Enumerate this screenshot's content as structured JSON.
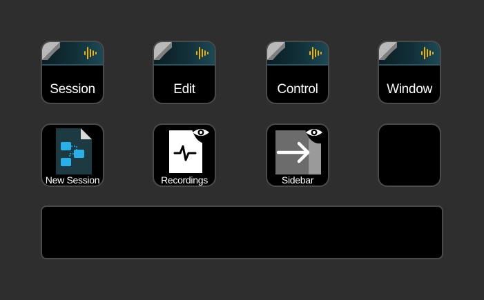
{
  "app": {
    "background": "#2e2e2e",
    "key_border": "#4a4a4a"
  },
  "row1": [
    {
      "label": "Session",
      "icon": "audio-waveform-icon",
      "kind": "folder"
    },
    {
      "label": "Edit",
      "icon": "audio-waveform-icon",
      "kind": "folder"
    },
    {
      "label": "Control",
      "icon": "audio-waveform-icon",
      "kind": "folder"
    },
    {
      "label": "Window",
      "icon": "audio-waveform-icon",
      "kind": "folder"
    }
  ],
  "row2": [
    {
      "label": "New Session",
      "icon": "new-session-document-icon"
    },
    {
      "label": "Recordings",
      "icon": "recordings-waveform-icon",
      "badge": "eye-icon"
    },
    {
      "label": "Sidebar",
      "icon": "sidebar-arrow-icon",
      "badge": "eye-icon"
    },
    {
      "label": "",
      "icon": "",
      "empty": true
    }
  ],
  "touch_strip": {
    "label": ""
  },
  "colors": {
    "waveform": "#e9b21a",
    "folder_band": "#123039",
    "session_blue": "#2ab0e6",
    "doc_bg": "#1d3942"
  }
}
